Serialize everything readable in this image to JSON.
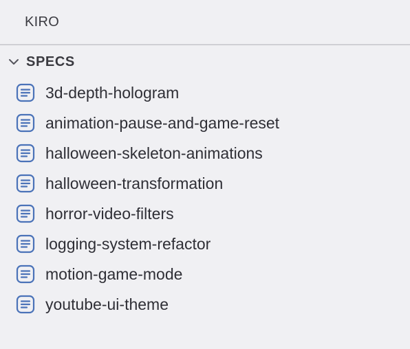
{
  "panel": {
    "title": "KIRO"
  },
  "section": {
    "title": "SPECS",
    "expanded": true,
    "chevron_icon": "chevron-down-icon"
  },
  "specs": {
    "icon": "document-lines-icon",
    "icon_color": "#4a72b8",
    "items": [
      {
        "label": "3d-depth-hologram"
      },
      {
        "label": "animation-pause-and-game-reset"
      },
      {
        "label": "halloween-skeleton-animations"
      },
      {
        "label": "halloween-transformation"
      },
      {
        "label": "horror-video-filters"
      },
      {
        "label": "logging-system-refactor"
      },
      {
        "label": "motion-game-mode"
      },
      {
        "label": "youtube-ui-theme"
      }
    ]
  }
}
